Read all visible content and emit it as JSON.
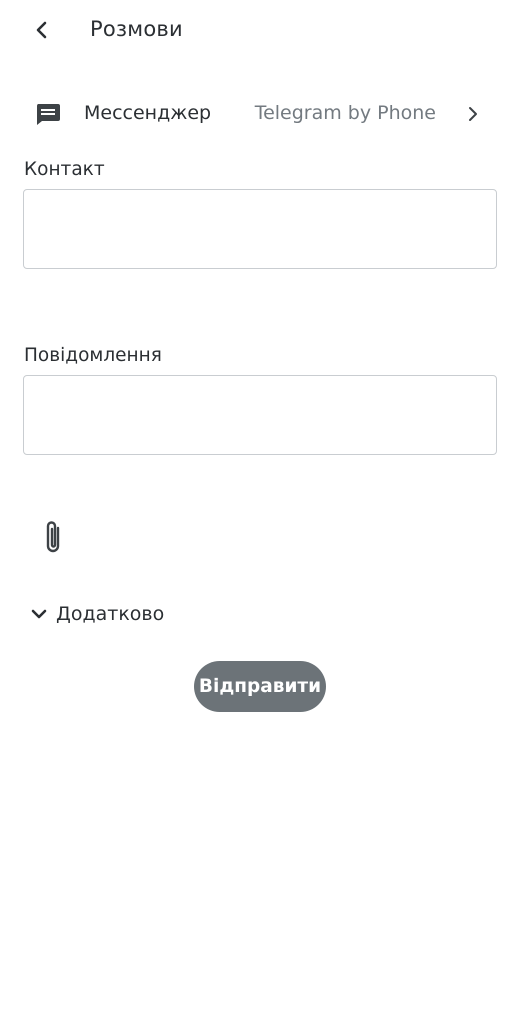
{
  "header": {
    "title": "Розмови",
    "back_icon": "chevron-left-icon"
  },
  "messenger": {
    "icon": "chat-message-icon",
    "label": "Мессенджер",
    "value": "Telegram by Phone",
    "chevron_icon": "chevron-right-icon"
  },
  "contact": {
    "label": "Контакт",
    "value": ""
  },
  "message": {
    "label": "Повідомлення",
    "value": ""
  },
  "attachment": {
    "icon": "paperclip-icon"
  },
  "advanced": {
    "label": "Додатково",
    "icon": "chevron-down-icon"
  },
  "send": {
    "label": "Відправити"
  },
  "colors": {
    "text": "#2b2f33",
    "muted_text": "#737a80",
    "border": "#c9cdd1",
    "button_bg": "#6c7378",
    "button_text": "#ffffff"
  }
}
